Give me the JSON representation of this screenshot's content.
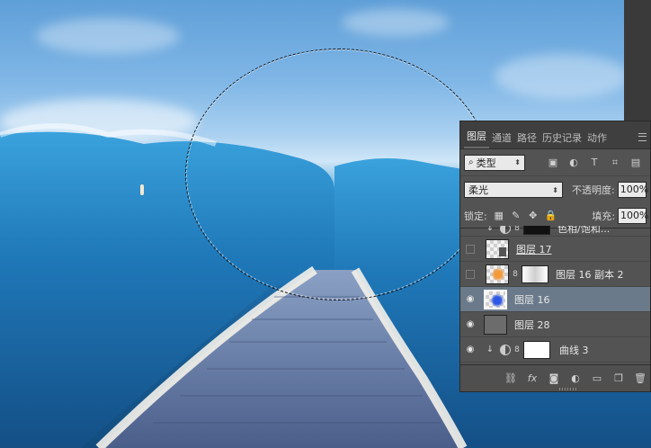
{
  "tabs": [
    {
      "label": "图层",
      "active": true
    },
    {
      "label": "通道"
    },
    {
      "label": "路径"
    },
    {
      "label": "历史记录"
    },
    {
      "label": "动作"
    }
  ],
  "filter": {
    "kind_label": "类型"
  },
  "blend": {
    "mode": "柔光",
    "opacity_label": "不透明度:",
    "opacity_value": "100%"
  },
  "lock": {
    "label": "锁定:",
    "fill_label": "填充:",
    "fill_value": "100%"
  },
  "layers": [
    {
      "name": "色相/饱和...",
      "visible": true
    },
    {
      "name": "图层 17",
      "visible": false
    },
    {
      "name": "图层 16 副本 2",
      "visible": false
    },
    {
      "name": "图层 16",
      "visible": true,
      "selected": true
    },
    {
      "name": "图层 28",
      "visible": true
    },
    {
      "name": "曲线 3",
      "visible": true
    }
  ],
  "footer": {
    "fx_label": "fx"
  },
  "colors": {
    "panel_bg": "#535353",
    "selected_row": "#6b7a8a"
  },
  "icons": {
    "eye": "eye-icon",
    "chain": "chain-link-icon",
    "lock": "lock-icon",
    "trash": "trash-icon"
  }
}
